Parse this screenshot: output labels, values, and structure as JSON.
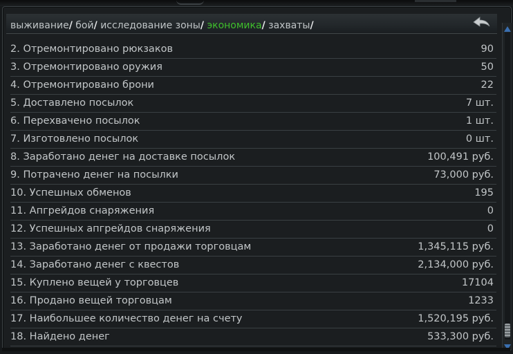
{
  "breadcrumb": {
    "items": [
      {
        "label": "выживание",
        "active": false
      },
      {
        "label": "бой",
        "active": false
      },
      {
        "label": "исследование зоны",
        "active": false
      },
      {
        "label": "экономика",
        "active": true
      },
      {
        "label": "захваты",
        "active": false
      }
    ],
    "separator": "/"
  },
  "colors": {
    "active_tab": "#3fbf2c",
    "text": "#c2c6c8",
    "row_divider": "#3a4043",
    "background": "#1b1e20"
  },
  "icons": {
    "back": "back-arrow-icon",
    "scroll_up": "triangle-up-icon",
    "scroll_down": "triangle-down-icon"
  },
  "scroll_position": 1.0,
  "stats": [
    {
      "label": "2. Отремонтировано рюкзаков",
      "value": "90"
    },
    {
      "label": "3. Отремонтировано оружия",
      "value": "50"
    },
    {
      "label": "4. Отремонтировано брони",
      "value": "22"
    },
    {
      "label": "5. Доставлено посылок",
      "value": "7 шт."
    },
    {
      "label": "6. Перехвачено посылок",
      "value": "1 шт."
    },
    {
      "label": "7. Изготовлено посылок",
      "value": "0 шт."
    },
    {
      "label": "8. Заработано денег на доставке посылок",
      "value": "100,491 руб."
    },
    {
      "label": "9. Потрачено денег на посылки",
      "value": "73,000 руб."
    },
    {
      "label": "10. Успешных обменов",
      "value": "195"
    },
    {
      "label": "11. Апгрейдов снаряжения",
      "value": "0"
    },
    {
      "label": "12. Успешных апгрейдов снаряжения",
      "value": "0"
    },
    {
      "label": "13. Заработано денег от продажи торговцам",
      "value": "1,345,115 руб."
    },
    {
      "label": "14. Заработано денег с квестов",
      "value": "2,134,000 руб."
    },
    {
      "label": "15. Куплено вещей у торговцев",
      "value": "17104"
    },
    {
      "label": "16. Продано вещей торговцам",
      "value": "1233"
    },
    {
      "label": "17. Наибольшее количество денег на счету",
      "value": "1,520,195 руб."
    },
    {
      "label": "18. Найдено денег",
      "value": "533,300 руб."
    }
  ]
}
